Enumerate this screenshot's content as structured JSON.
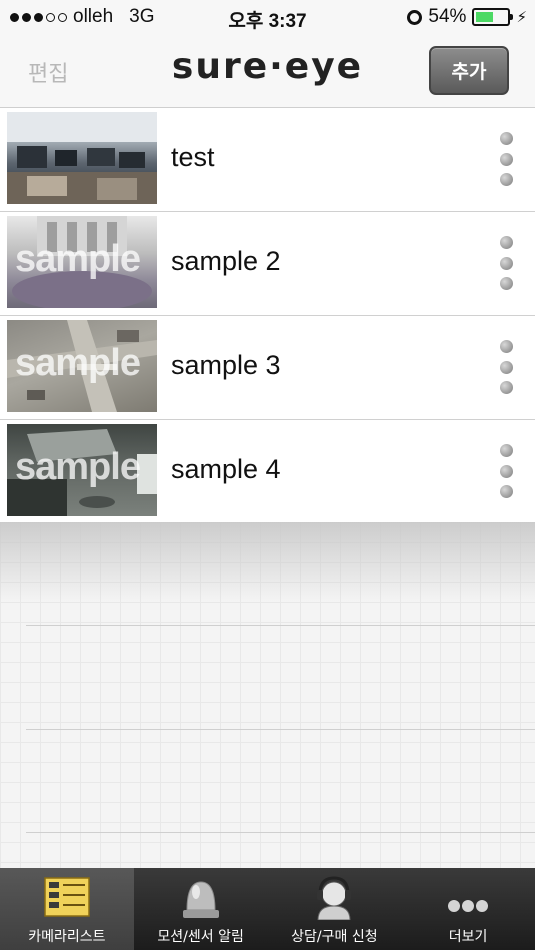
{
  "status": {
    "carrier": "olleh",
    "network": "3G",
    "time": "오후 3:37",
    "battery": "54%",
    "battery_level": 0.54
  },
  "nav": {
    "edit_label": "편집",
    "logo": "sure·eye",
    "add_label": "추가"
  },
  "cameras": [
    {
      "name": "test",
      "thumb_text": ""
    },
    {
      "name": "sample 2",
      "thumb_text": "sample"
    },
    {
      "name": "sample 3",
      "thumb_text": "sample"
    },
    {
      "name": "sample 4",
      "thumb_text": "sample"
    }
  ],
  "tabs": [
    {
      "label": "카메라리스트",
      "icon": "camera-list-icon"
    },
    {
      "label": "모션/센서 알림",
      "icon": "siren-icon"
    },
    {
      "label": "상담/구매 신청",
      "icon": "headset-agent-icon"
    },
    {
      "label": "더보기",
      "icon": "more-dots-icon"
    }
  ],
  "colors": {
    "battery_fill": "#4cd964",
    "tab_bar": "#2a2a2a",
    "add_button": "#6f6f6f"
  }
}
